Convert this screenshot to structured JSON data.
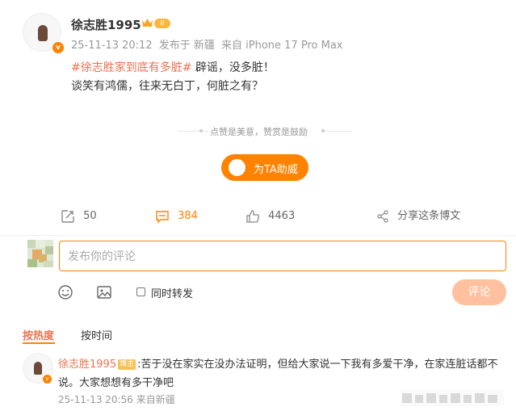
{
  "post": {
    "username": "徐志胜1995",
    "level_badge": "II",
    "verified_mark": "v",
    "time": "25-11-13 20:12",
    "location": "发布于 新疆",
    "device": "来自 iPhone 17 Pro Max",
    "hashtag": "#徐志胜家到底有多脏#",
    "text1": " 辟谣，没多脏！",
    "text2": "谈笑有鸿儒，往来无白丁，何脏之有？"
  },
  "reward": {
    "tip": "点赞是美意，赞赏是鼓励",
    "button": "为TA助威"
  },
  "actions": {
    "repost": "50",
    "comments": "384",
    "likes": "4463",
    "share": "分享这条博文"
  },
  "composer": {
    "placeholder": "发布你的评论",
    "also_repost": "同时转发",
    "submit": "评论"
  },
  "tabs": {
    "hot": "按热度",
    "time": "按时间"
  },
  "comment": {
    "user": "徐志胜1995",
    "badge": "博主",
    "text": ":苦于没在家实在没办法证明，但给大家说一下我有多爱干净，在家连脏话都不说。大家想想有多干净吧",
    "time": "25-11-13 20:56",
    "source": "来自新疆"
  },
  "colors": {
    "accent": "#ff8200",
    "link": "#eb7350"
  },
  "icons": [
    "repost-icon",
    "comment-icon",
    "like-icon",
    "share-icon",
    "emoji-icon",
    "image-icon",
    "crown-icon"
  ]
}
